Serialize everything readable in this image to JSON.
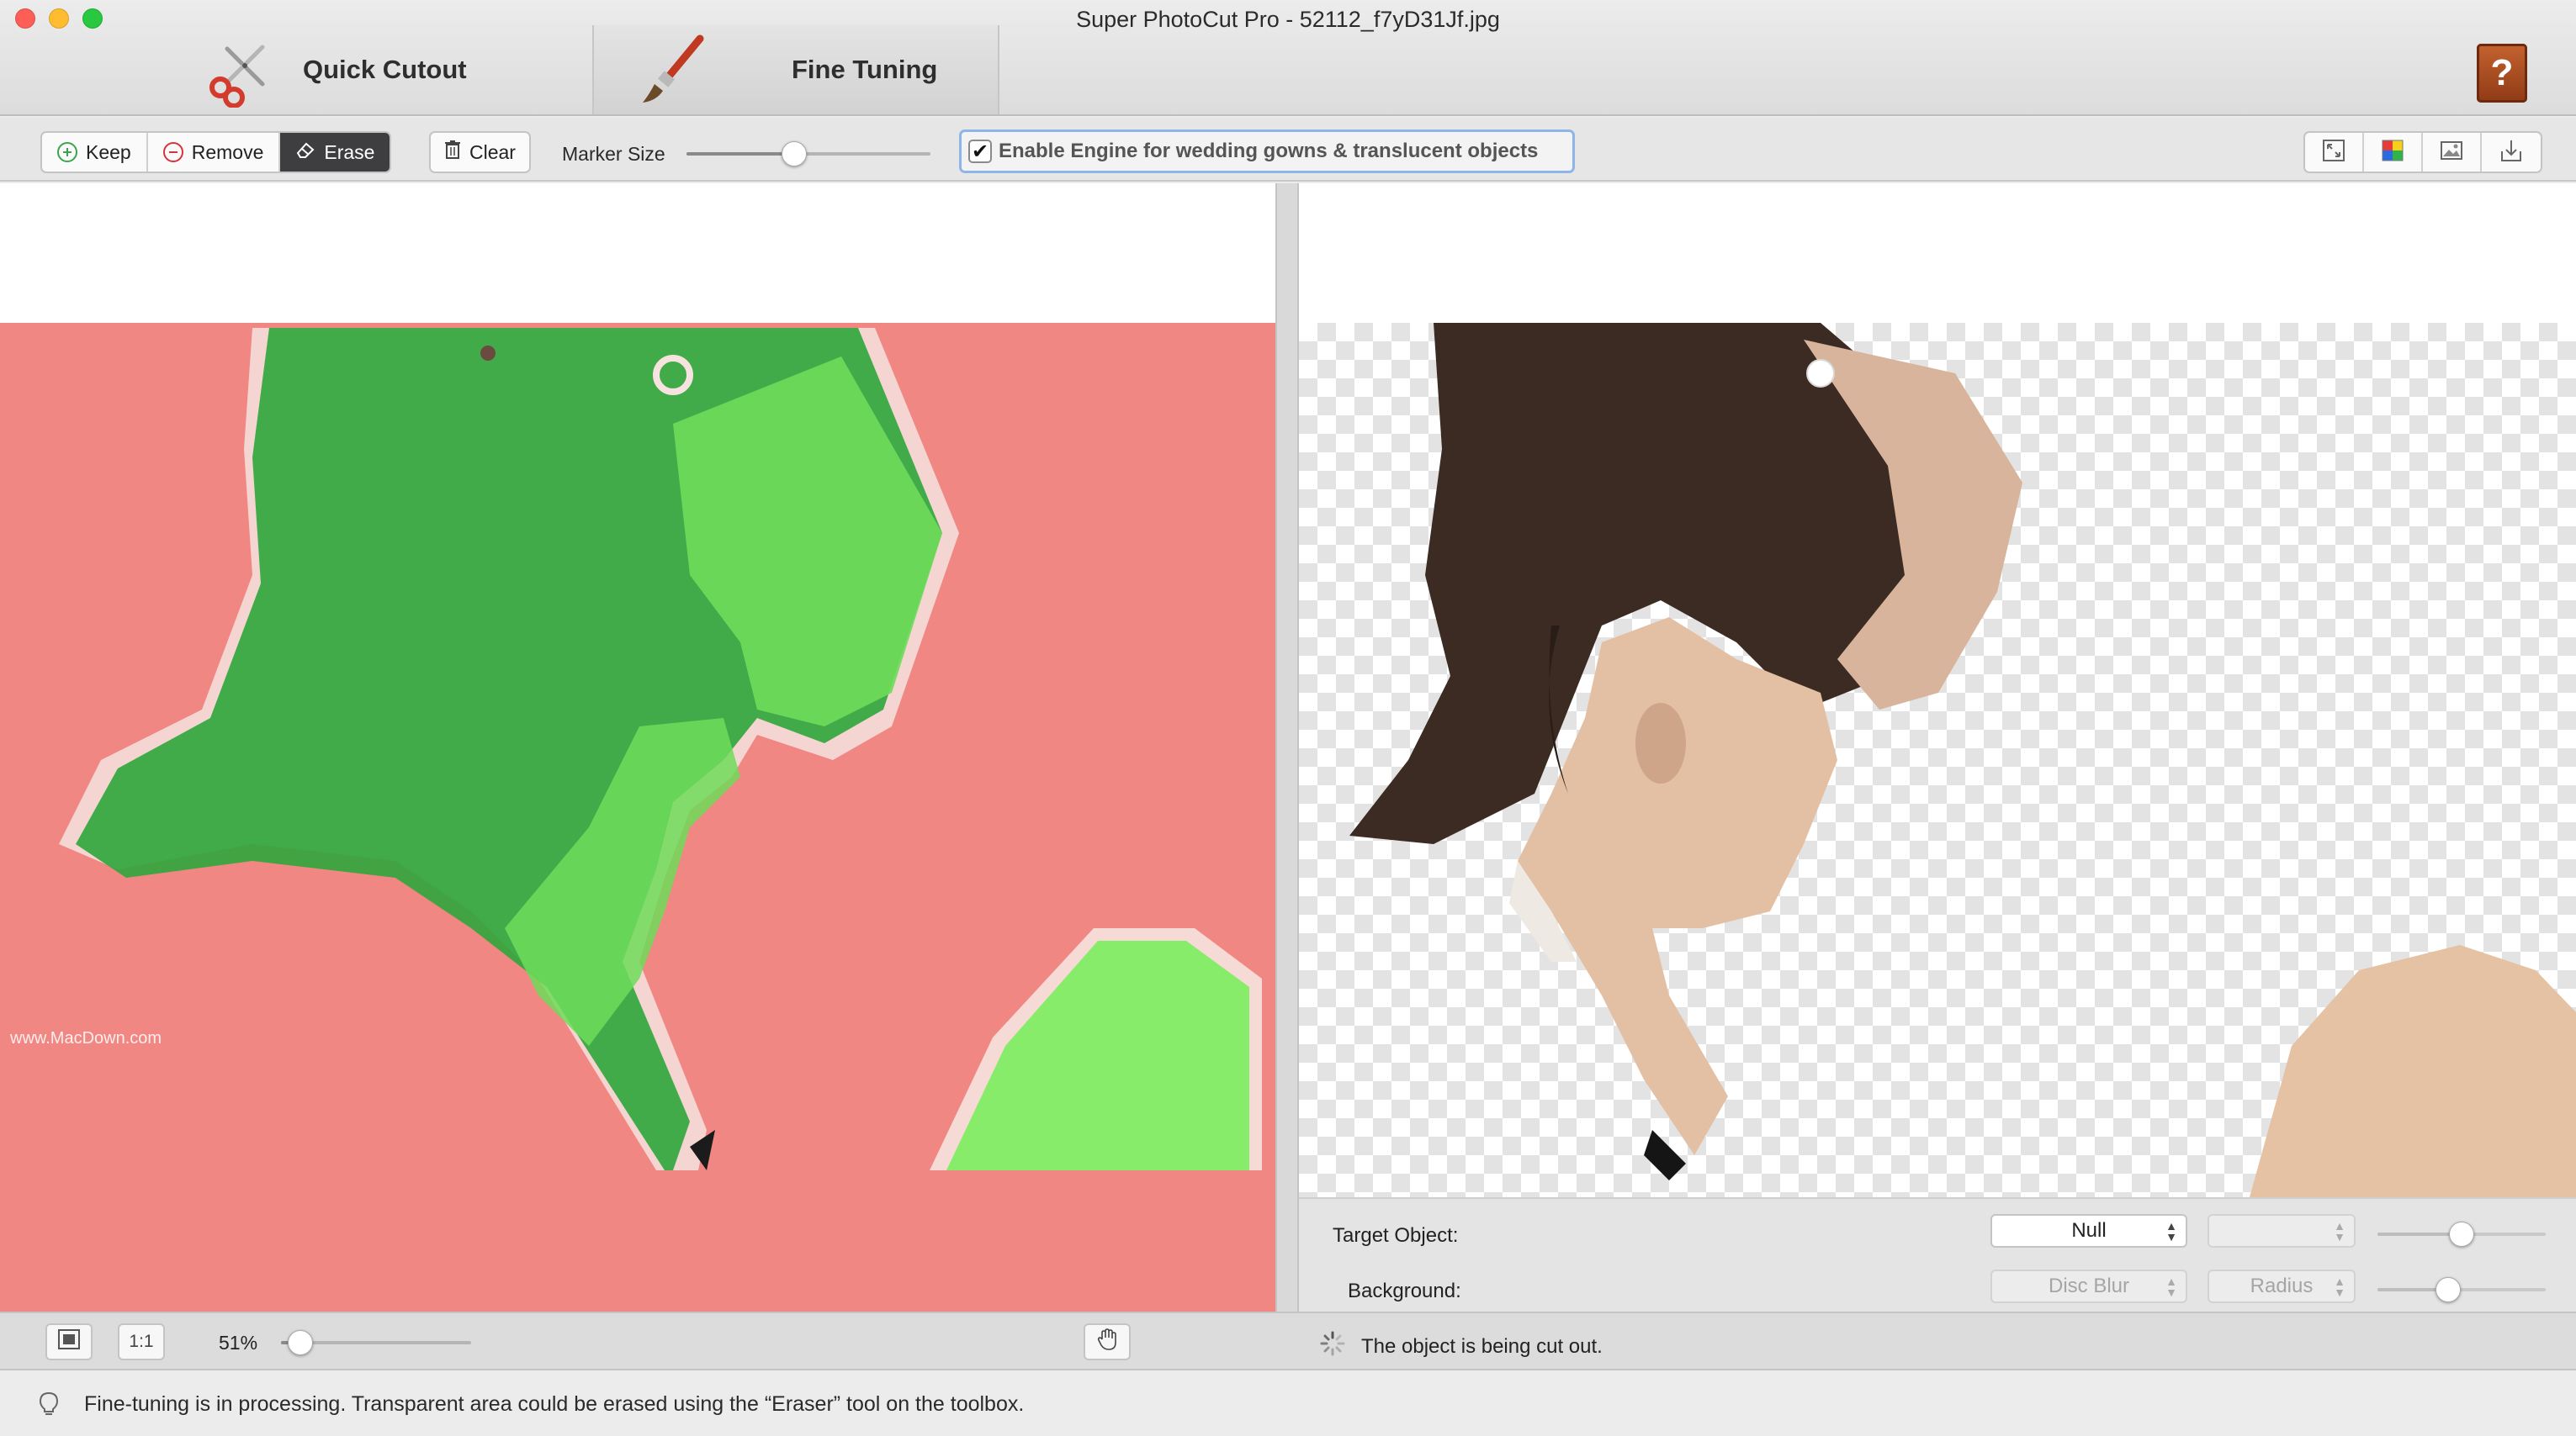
{
  "window": {
    "title": "Super PhotoCut Pro - 52112_f7yD31Jf.jpg"
  },
  "tabs": [
    {
      "label": "Quick Cutout",
      "icon": "scissors-icon",
      "active": false
    },
    {
      "label": "Fine Tuning",
      "icon": "paintbrush-icon",
      "active": true
    }
  ],
  "toolbar": {
    "keep_label": "Keep",
    "remove_label": "Remove",
    "erase_label": "Erase",
    "active_tool": "Erase",
    "clear_label": "Clear",
    "marker_size_label": "Marker Size",
    "marker_size_value": 0.44,
    "engine_checkbox_label": "Enable Engine for wedding gowns & translucent objects",
    "engine_checked": true,
    "view_buttons": [
      "fit-view-icon",
      "color-view-icon",
      "image-view-icon",
      "export-icon"
    ]
  },
  "canvas": {
    "watermark": "www.MacDown.com",
    "left_colors": {
      "background_mask": "#f18783",
      "keep_mask": "#2ea63a",
      "keep_mask_light": "#86ec6a"
    }
  },
  "controls": {
    "target_object_label": "Target Object:",
    "target_object_value": "Null",
    "target_object_secondary_value": "",
    "target_slider_value": 0.5,
    "background_label": "Background:",
    "background_value": "Disc Blur",
    "radius_value": "Radius",
    "background_slider_value": 0.42
  },
  "bottombar": {
    "fit_button": "fit-screen-icon",
    "actual_size_label": "1:1",
    "zoom_label": "51%",
    "zoom_slider_value": 0.1,
    "hand_tool": "hand-icon",
    "processing_text": "The object is being cut out."
  },
  "statusbar": {
    "message": "Fine-tuning is in processing. Transparent area could be erased using the “Eraser” tool on the toolbox."
  },
  "colors": {
    "accent_focus": "#8fb4e8",
    "active_segment": "#3e3e40",
    "help_book": "#b2532a"
  }
}
